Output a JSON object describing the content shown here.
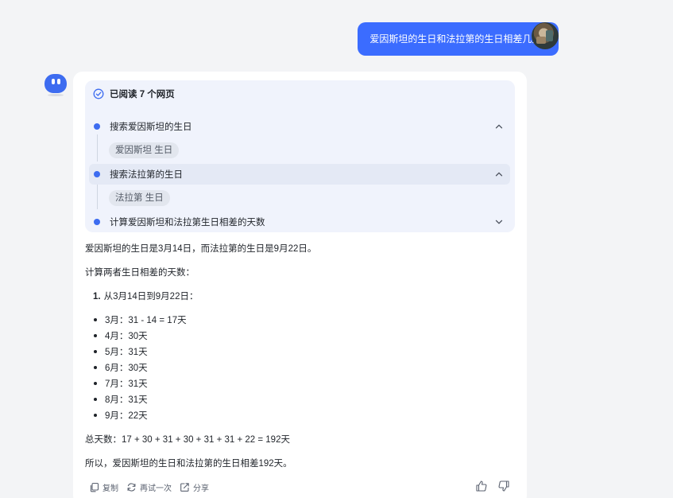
{
  "user_message": "爱因斯坦的生日和法拉第的生日相差几天?",
  "search_panel": {
    "title": "已阅读 7 个网页",
    "steps": [
      {
        "label": "搜索爱因斯坦的生日",
        "chip": "爱因斯坦 生日",
        "expanded": true
      },
      {
        "label": "搜索法拉第的生日",
        "chip": "法拉第 生日",
        "expanded": true
      },
      {
        "label": "计算爱因斯坦和法拉第生日相差的天数",
        "expanded": false
      }
    ]
  },
  "answer": {
    "intro": "爱因斯坦的生日是3月14日，而法拉第的生日是9月22日。",
    "calc_heading": "计算两者生日相差的天数：",
    "ol_number": "1.",
    "ol_text": "从3月14日到9月22日：",
    "bullets": [
      "3月：31 - 14 = 17天",
      "4月：30天",
      "5月：31天",
      "6月：30天",
      "7月：31天",
      "8月：31天",
      "9月：22天"
    ],
    "total": "总天数：17 + 30 + 31 + 30 + 31 + 31 + 22 = 192天",
    "conclusion": "所以，爱因斯坦的生日和法拉第的生日相差192天。"
  },
  "actions": {
    "copy": "复制",
    "retry": "再试一次",
    "share": "分享"
  },
  "colors": {
    "accent": "#3d6cf0",
    "user_bubble": "#3b6cff",
    "background": "#f3f4f6",
    "panel": "#f0f3fc"
  }
}
